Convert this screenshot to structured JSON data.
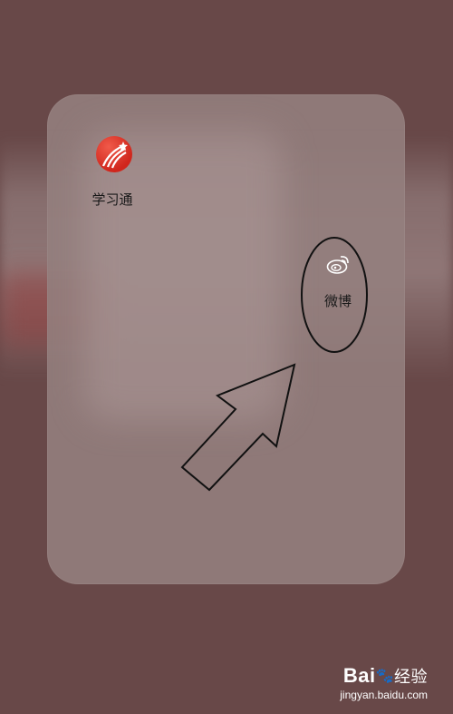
{
  "folder": {
    "apps": [
      {
        "name": "学习通",
        "icon": "xuexitong-icon",
        "color": "#d0261c"
      },
      {
        "name": "微博",
        "icon": "weibo-icon"
      }
    ]
  },
  "annotation": {
    "highlight": "ellipse-around-weibo",
    "pointer": "arrow-pointing-up-right"
  },
  "watermark": {
    "brand_prefix": "Bai",
    "brand_suffix": "经验",
    "url": "jingyan.baidu.com"
  }
}
